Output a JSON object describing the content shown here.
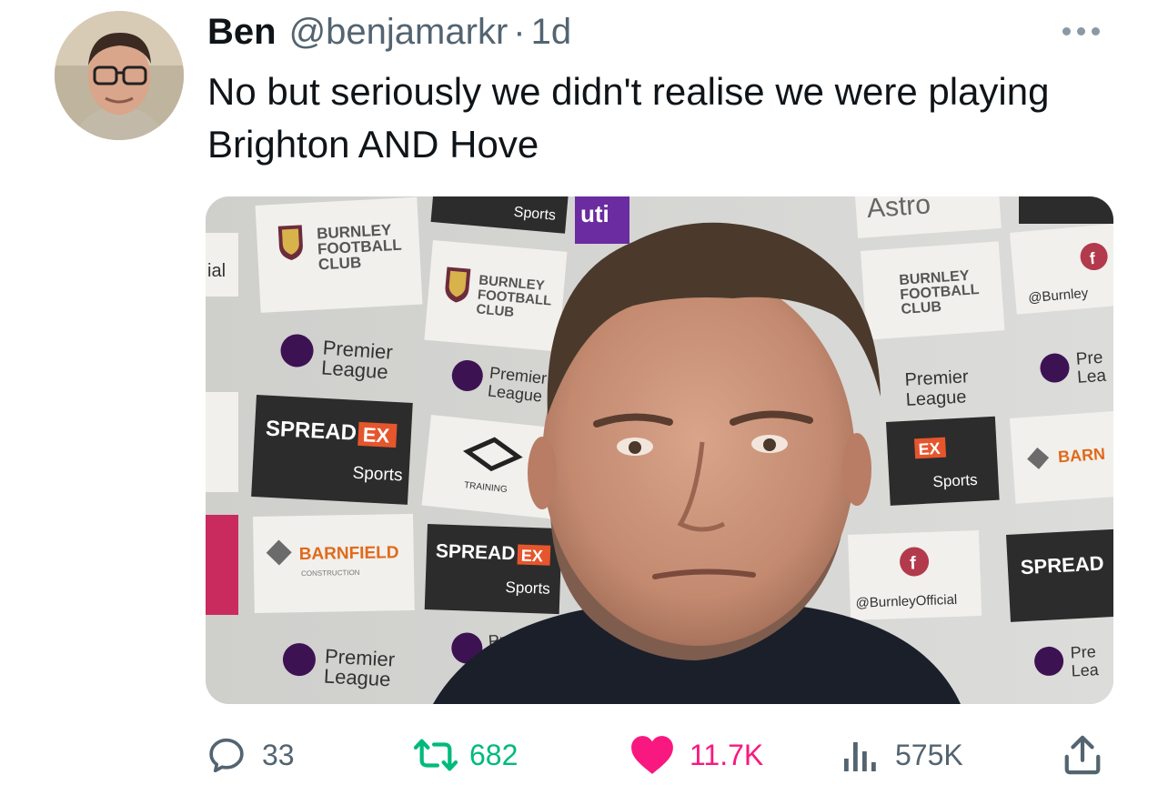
{
  "tweet": {
    "author_name": "Ben",
    "author_handle": "@benjamarkr",
    "separator": "·",
    "time": "1d",
    "text": "No but seriously we didn't realise we were playing Brighton AND Hove",
    "avatar_icon": "profile-photo"
  },
  "media": {
    "board_texts": {
      "burnley_fc": [
        "BURNLEY",
        "FOOTBALL",
        "CLUB"
      ],
      "premier_league": [
        "Premier",
        "League"
      ],
      "spreadex": [
        "SPREAD",
        "EX"
      ],
      "sports": "Sports",
      "barnfield": "BARNFIELD",
      "construction": "CONSTRUCTION",
      "facebook": "@BurnleyOfficial",
      "facebook_short": "@Burnley",
      "facebook_icon": "f",
      "training": "TRAINING",
      "partial_left": "ial",
      "partial_barn": "BARN",
      "partial_spread": "SPREAD",
      "partial_pre": "Pre",
      "partial_lea": "Lea",
      "partial_astro": "Astro",
      "partial_util": "uti"
    }
  },
  "actions": {
    "replies": "33",
    "retweets": "682",
    "likes": "11.7K",
    "views": "575K"
  },
  "colors": {
    "text_primary": "#0f1419",
    "text_secondary": "#536471",
    "retweet_green": "#00ba7c",
    "like_pink": "#f91880",
    "board_dark": "#2c2c2c",
    "board_light": "#f1f0ec",
    "spreadex_orange": "#e5562c"
  }
}
